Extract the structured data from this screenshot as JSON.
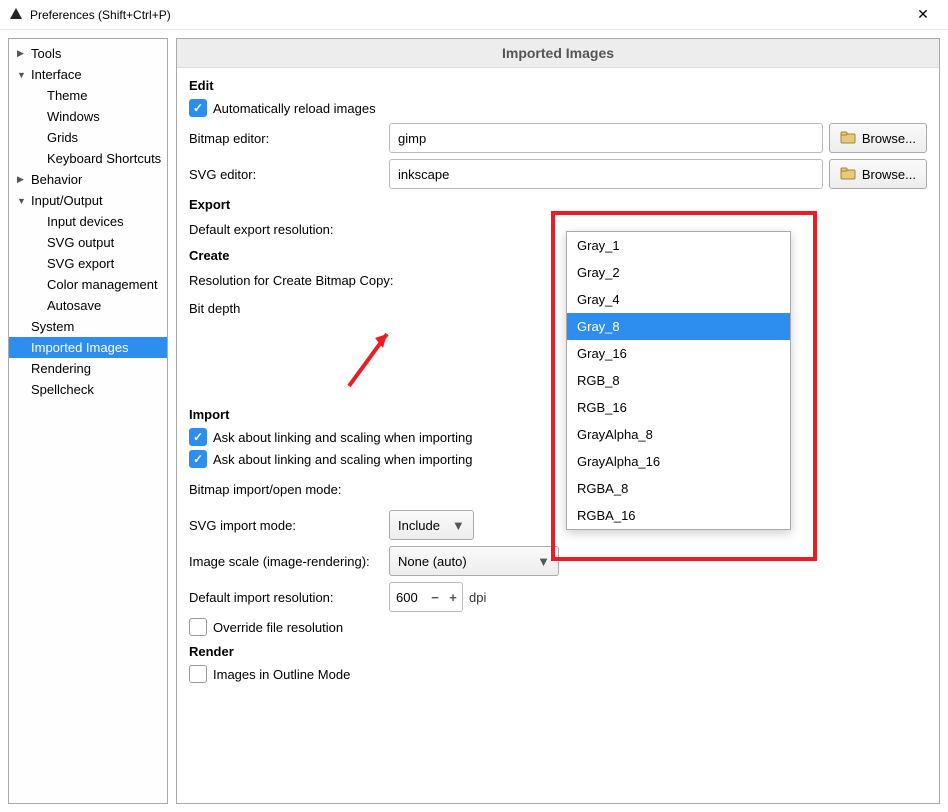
{
  "window": {
    "title": "Preferences (Shift+Ctrl+P)"
  },
  "sidebar": {
    "items": [
      {
        "label": "Tools",
        "level": "l1",
        "tri": "▶",
        "sel": false
      },
      {
        "label": "Interface",
        "level": "l1",
        "tri": "▼",
        "sel": false
      },
      {
        "label": "Theme",
        "level": "l2",
        "tri": "",
        "sel": false
      },
      {
        "label": "Windows",
        "level": "l2",
        "tri": "",
        "sel": false
      },
      {
        "label": "Grids",
        "level": "l2",
        "tri": "",
        "sel": false
      },
      {
        "label": "Keyboard Shortcuts",
        "level": "l2",
        "tri": "",
        "sel": false
      },
      {
        "label": "Behavior",
        "level": "l1",
        "tri": "▶",
        "sel": false
      },
      {
        "label": "Input/Output",
        "level": "l1",
        "tri": "▼",
        "sel": false
      },
      {
        "label": "Input devices",
        "level": "l2",
        "tri": "",
        "sel": false
      },
      {
        "label": "SVG output",
        "level": "l2",
        "tri": "",
        "sel": false
      },
      {
        "label": "SVG export",
        "level": "l2",
        "tri": "",
        "sel": false
      },
      {
        "label": "Color management",
        "level": "l2",
        "tri": "",
        "sel": false
      },
      {
        "label": "Autosave",
        "level": "l2",
        "tri": "",
        "sel": false
      },
      {
        "label": "System",
        "level": "l1",
        "tri": "",
        "sel": false
      },
      {
        "label": "Imported Images",
        "level": "l1",
        "tri": "",
        "sel": true
      },
      {
        "label": "Rendering",
        "level": "l1",
        "tri": "",
        "sel": false
      },
      {
        "label": "Spellcheck",
        "level": "l1",
        "tri": "",
        "sel": false
      }
    ]
  },
  "page": {
    "title": "Imported Images",
    "sections": {
      "edit": "Edit",
      "export": "Export",
      "create": "Create",
      "import": "Import",
      "render": "Render"
    },
    "labels": {
      "auto_reload": "Automatically reload images",
      "bitmap_editor": "Bitmap editor:",
      "svg_editor": "SVG editor:",
      "default_export_res": "Default export resolution:",
      "create_bitmap_res": "Resolution for Create Bitmap Copy:",
      "bit_depth": "Bit depth",
      "ask_link_scale_1": "Ask about linking and scaling when importing",
      "ask_link_scale_2": "Ask about linking and scaling when importing",
      "bitmap_import_mode": "Bitmap import/open mode:",
      "svg_import_mode": "SVG import mode:",
      "image_scale": "Image scale (image-rendering):",
      "default_import_res": "Default import resolution:",
      "override_file_res": "Override file resolution",
      "images_outline": "Images in Outline Mode"
    },
    "values": {
      "bitmap_editor": "gimp",
      "svg_editor": "inkscape",
      "svg_import_mode": "Include",
      "image_scale": "None (auto)",
      "import_res": "600",
      "import_res_unit": "dpi"
    },
    "browse": "Browse..."
  },
  "dropdown": {
    "options": [
      "Gray_1",
      "Gray_2",
      "Gray_4",
      "Gray_8",
      "Gray_16",
      "RGB_8",
      "RGB_16",
      "GrayAlpha_8",
      "GrayAlpha_16",
      "RGBA_8",
      "RGBA_16"
    ],
    "selected": "Gray_8"
  }
}
